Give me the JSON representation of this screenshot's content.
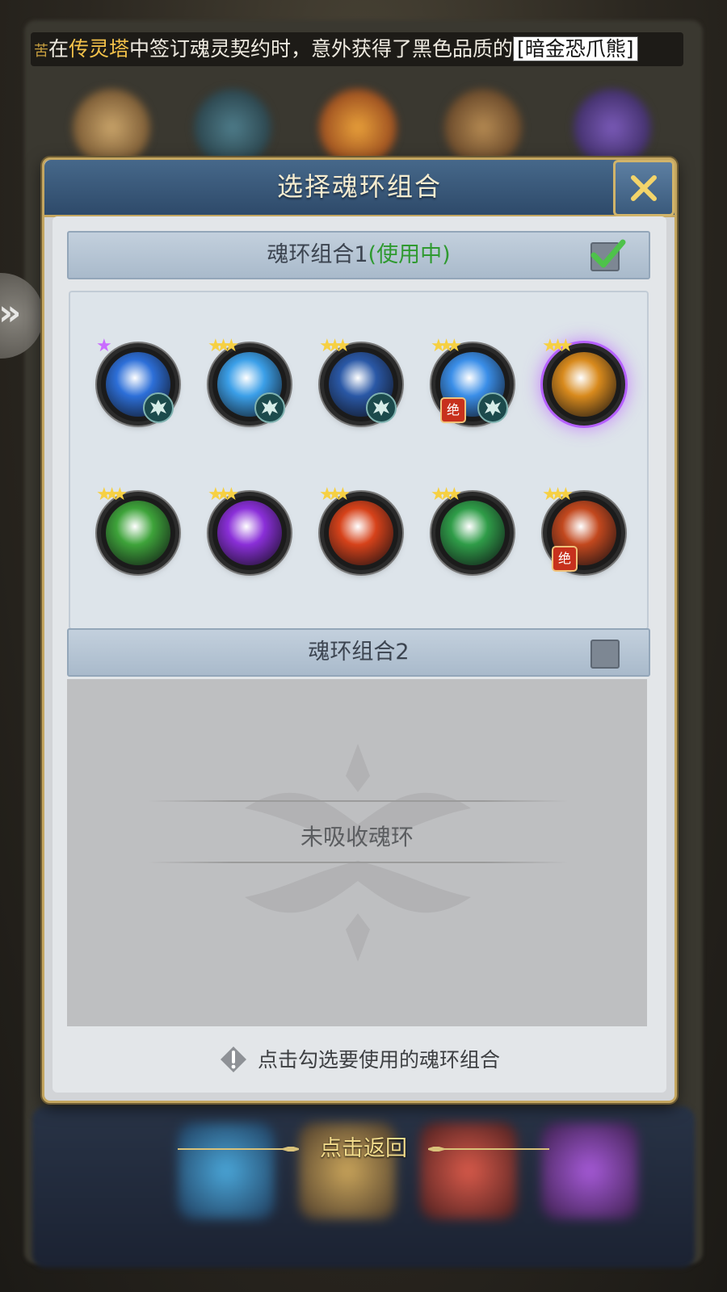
{
  "ticker": {
    "prefix_fragment": "苦",
    "text_before": "在",
    "location": "传灵塔",
    "text_middle": "中签订魂灵契约时，意外获得了黑色品质的",
    "item_name": "[暗金恐爪熊]"
  },
  "side_tab": {
    "glyph": "»"
  },
  "dialog": {
    "title": "选择魂环组合",
    "close_glyph": "✕"
  },
  "groups": [
    {
      "label": "魂环组合1",
      "status": "(使用中)",
      "checked": true
    },
    {
      "label": "魂环组合2",
      "status": "",
      "checked": false
    }
  ],
  "rings_group1": [
    {
      "icon": "blue-claw-beast-icon",
      "stars": 1,
      "star_color": "#c96cff",
      "badge": "bad-spirit-icon",
      "theme": "#2d6fd8"
    },
    {
      "icon": "blue-orb-icon",
      "stars": 3,
      "star_color": "#f6d043",
      "badge": "bad-spirit-icon",
      "theme": "#3b9fe8"
    },
    {
      "icon": "blue-blade-icon",
      "stars": 3,
      "star_color": "#f6d043",
      "badge": "bad-spirit-icon",
      "theme": "#2a58a6"
    },
    {
      "icon": "blue-sphere-icon",
      "stars": 3,
      "star_color": "#f6d043",
      "badge": "bad-spirit-icon",
      "extra_badge": "绝",
      "theme": "#3a8ee8"
    },
    {
      "icon": "golden-swirl-shield-icon",
      "stars": 3,
      "star_color": "#f6d043",
      "glow": true,
      "theme": "#d88a1d"
    },
    {
      "icon": "green-sprout-icon",
      "stars": 3,
      "star_color": "#f6d043",
      "theme": "#3ea33a"
    },
    {
      "icon": "purple-crystal-icon",
      "stars": 3,
      "star_color": "#f6d043",
      "theme": "#8a2fd8"
    },
    {
      "icon": "fire-demon-icon",
      "stars": 3,
      "star_color": "#f6d043",
      "theme": "#d6421a"
    },
    {
      "icon": "green-shield-icon",
      "stars": 3,
      "star_color": "#f6d043",
      "theme": "#2f9c48"
    },
    {
      "icon": "fire-dragon-icon",
      "stars": 3,
      "star_color": "#f6d043",
      "extra_badge": "绝",
      "theme": "#c2481e"
    }
  ],
  "group2_empty_text": "未吸收魂环",
  "hint": "点击勾选要使用的魂环组合",
  "tap_return": "点击返回",
  "colors": {
    "header_blue": "#2e4a6a",
    "gold_border": "#c4a660",
    "in_use_green": "#2f9a30"
  }
}
